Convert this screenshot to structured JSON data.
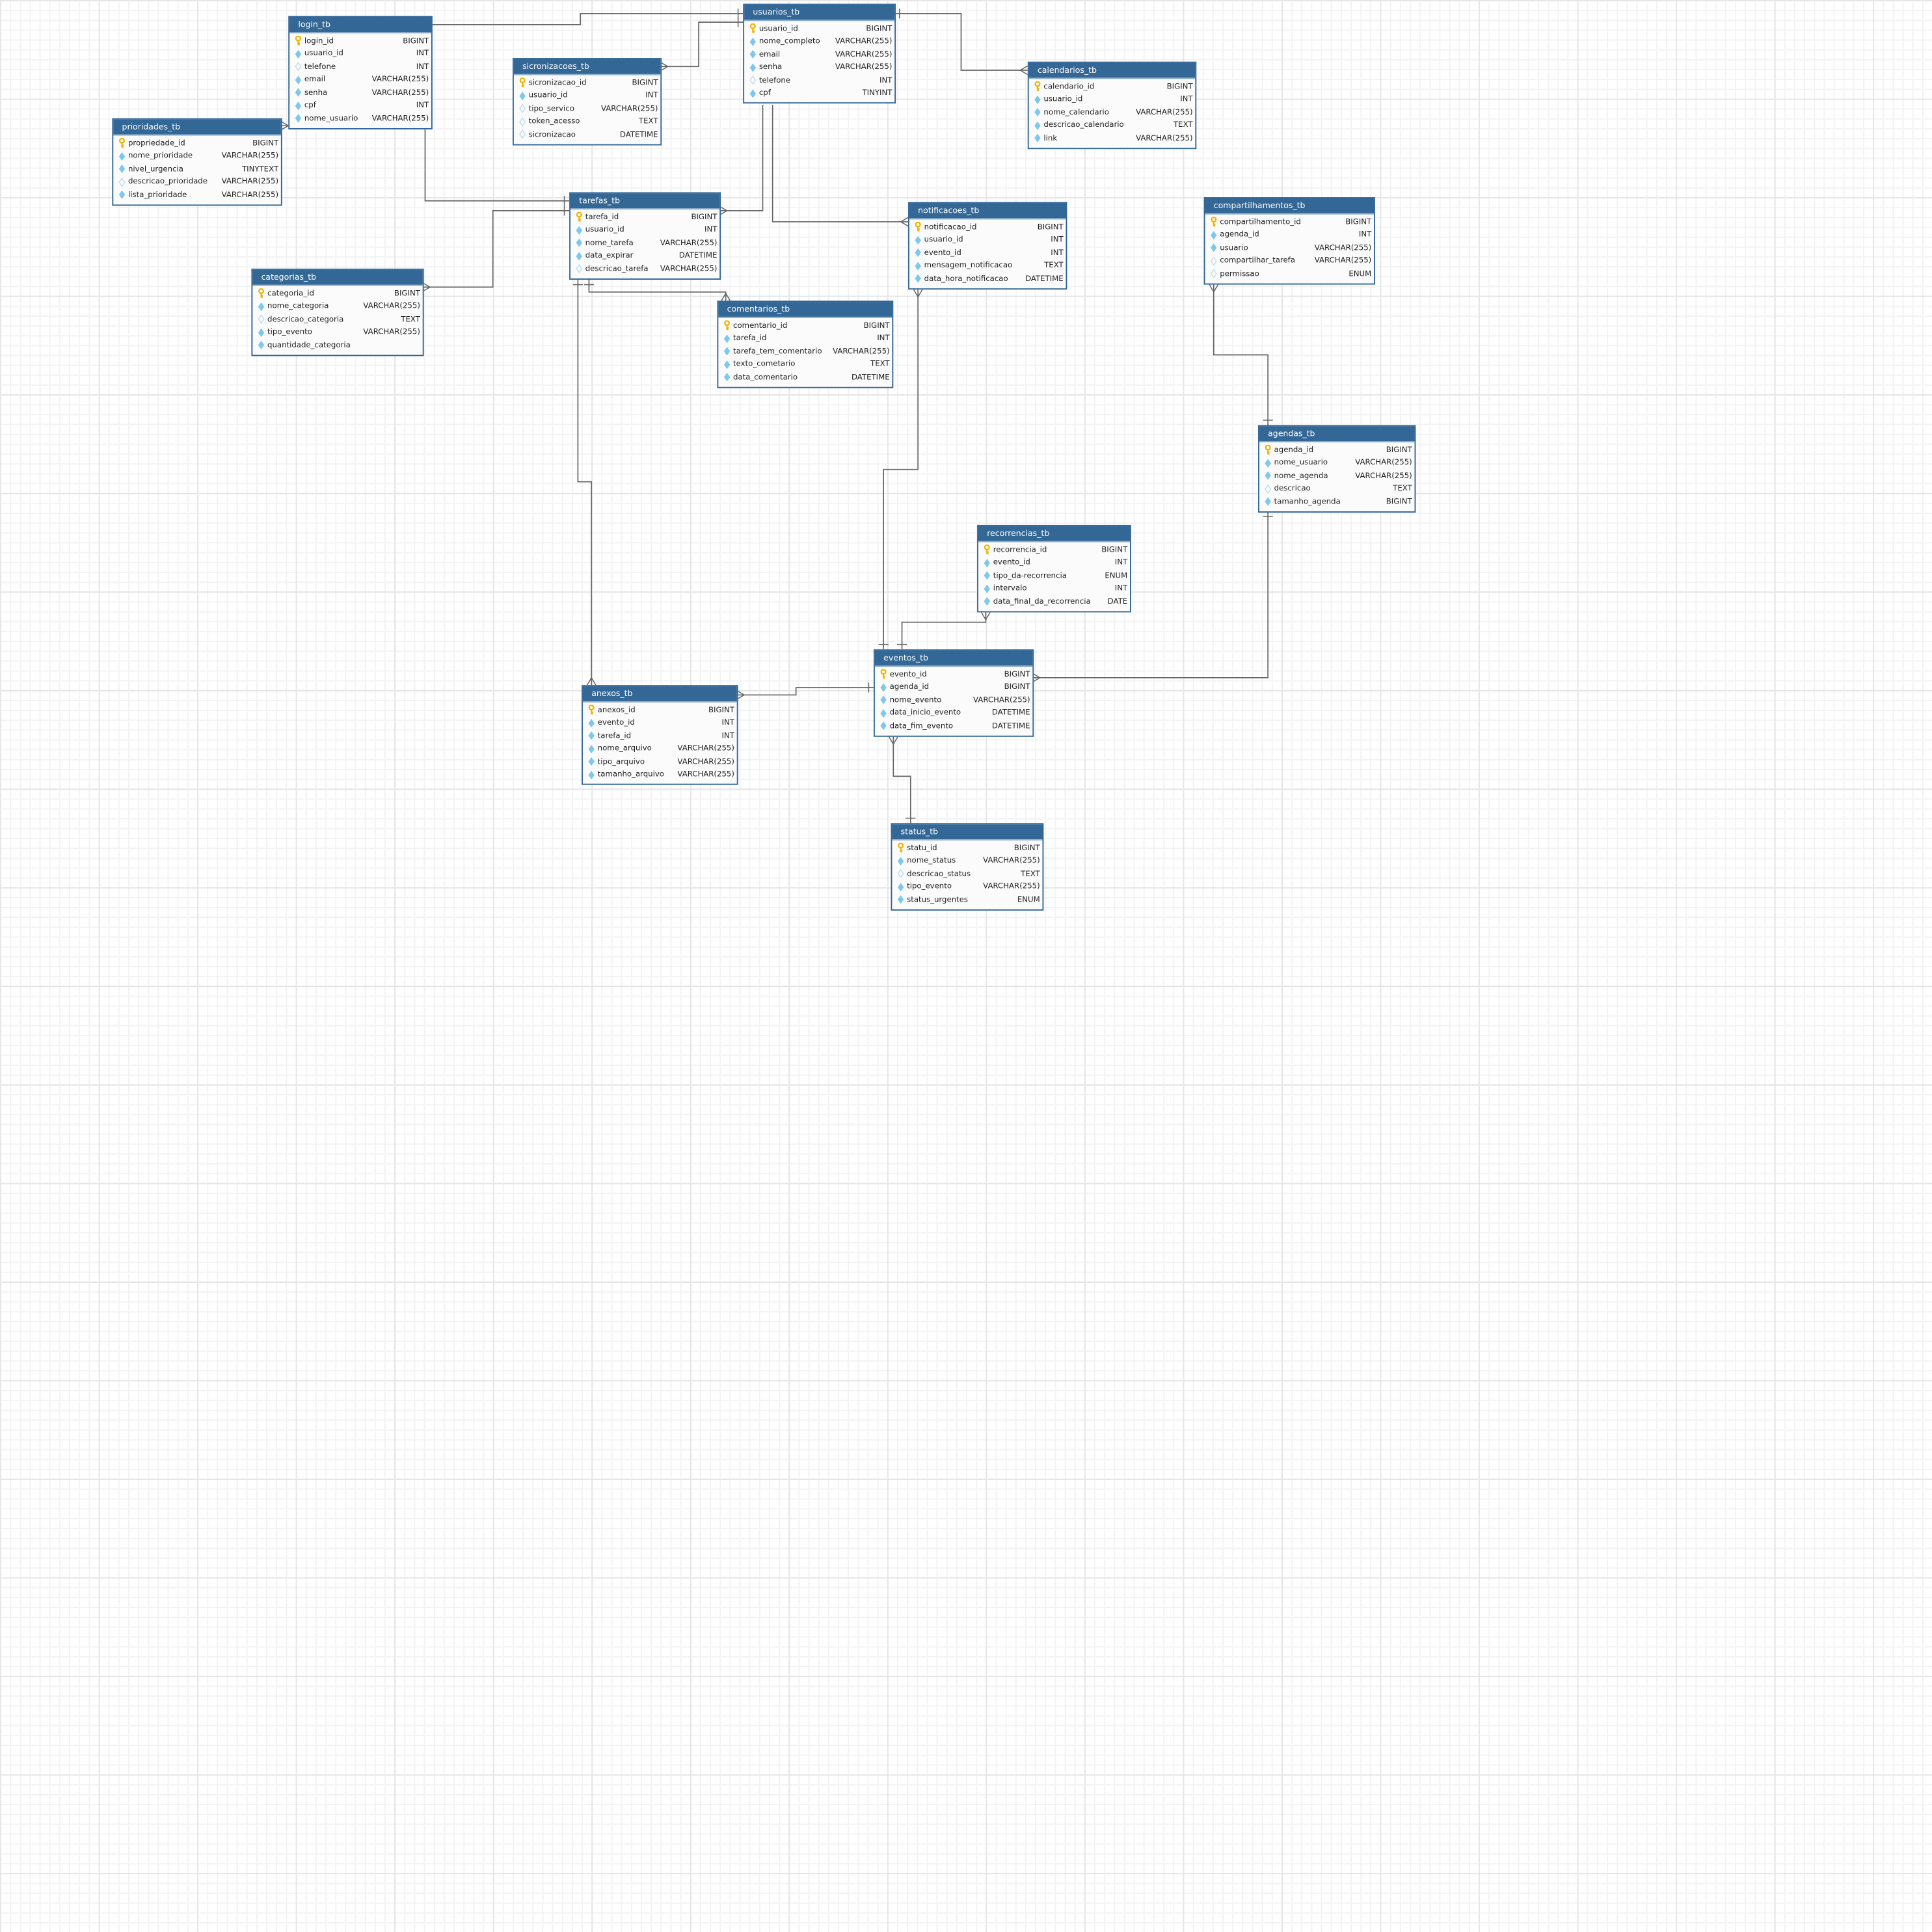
{
  "colors": {
    "header": "#336795",
    "border": "#336699",
    "pk": "#f2b400",
    "field": "#7cc8ef",
    "line": "#666666"
  },
  "tables": [
    {
      "id": "login_tb",
      "name": "login_tb",
      "columns": [
        {
          "name": "login_id",
          "type": "BIGINT",
          "icon": "key"
        },
        {
          "name": "usuario_id",
          "type": "INT",
          "icon": "diamond"
        },
        {
          "name": "telefone",
          "type": "INT",
          "icon": "diamond-outline"
        },
        {
          "name": "email",
          "type": "VARCHAR(255)",
          "icon": "diamond"
        },
        {
          "name": "senha",
          "type": "VARCHAR(255)",
          "icon": "diamond"
        },
        {
          "name": "cpf",
          "type": "INT",
          "icon": "diamond"
        },
        {
          "name": "nome_usuario",
          "type": "VARCHAR(255)",
          "icon": "diamond"
        }
      ]
    },
    {
      "id": "usuarios_tb",
      "name": "usuarios_tb",
      "columns": [
        {
          "name": "usuario_id",
          "type": "BIGINT",
          "icon": "key"
        },
        {
          "name": "nome_completo",
          "type": "VARCHAR(255)",
          "icon": "diamond"
        },
        {
          "name": "email",
          "type": "VARCHAR(255)",
          "icon": "diamond"
        },
        {
          "name": "senha",
          "type": "VARCHAR(255)",
          "icon": "diamond"
        },
        {
          "name": "telefone",
          "type": "INT",
          "icon": "diamond-outline"
        },
        {
          "name": "cpf",
          "type": "TINYINT",
          "icon": "diamond"
        }
      ]
    },
    {
      "id": "sicronizacoes_tb",
      "name": "sicronizacoes_tb",
      "columns": [
        {
          "name": "sicronizacao_id",
          "type": "BIGINT",
          "icon": "key"
        },
        {
          "name": "usuario_id",
          "type": "INT",
          "icon": "diamond"
        },
        {
          "name": "tipo_servico",
          "type": "VARCHAR(255)",
          "icon": "diamond-outline"
        },
        {
          "name": "token_acesso",
          "type": "TEXT",
          "icon": "diamond-outline"
        },
        {
          "name": "sicronizacao",
          "type": "DATETIME",
          "icon": "diamond-outline"
        }
      ]
    },
    {
      "id": "prioridades_tb",
      "name": "prioridades_tb",
      "columns": [
        {
          "name": "propriedade_id",
          "type": "BIGINT",
          "icon": "key"
        },
        {
          "name": "nome_prioridade",
          "type": "VARCHAR(255)",
          "icon": "diamond"
        },
        {
          "name": "nivel_urgencia",
          "type": "TINYTEXT",
          "icon": "diamond"
        },
        {
          "name": "descricao_prioridade",
          "type": "VARCHAR(255)",
          "icon": "diamond-outline"
        },
        {
          "name": "lista_prioridade",
          "type": "VARCHAR(255)",
          "icon": "diamond"
        }
      ]
    },
    {
      "id": "calendarios_tb",
      "name": "calendarios_tb",
      "columns": [
        {
          "name": "calendario_id",
          "type": "BIGINT",
          "icon": "key"
        },
        {
          "name": "usuario_id",
          "type": "INT",
          "icon": "diamond"
        },
        {
          "name": "nome_calendario",
          "type": "VARCHAR(255)",
          "icon": "diamond"
        },
        {
          "name": "descricao_calendario",
          "type": "TEXT",
          "icon": "diamond"
        },
        {
          "name": "link",
          "type": "VARCHAR(255)",
          "icon": "diamond"
        }
      ]
    },
    {
      "id": "tarefas_tb",
      "name": "tarefas_tb",
      "columns": [
        {
          "name": "tarefa_id",
          "type": "BIGINT",
          "icon": "key"
        },
        {
          "name": "usuario_id",
          "type": "INT",
          "icon": "diamond"
        },
        {
          "name": "nome_tarefa",
          "type": "VARCHAR(255)",
          "icon": "diamond"
        },
        {
          "name": "data_expirar",
          "type": "DATETIME",
          "icon": "diamond"
        },
        {
          "name": "descricao_tarefa",
          "type": "VARCHAR(255)",
          "icon": "diamond-outline"
        }
      ]
    },
    {
      "id": "notificacoes_tb",
      "name": "notificacoes_tb",
      "columns": [
        {
          "name": "notificacao_id",
          "type": "BIGINT",
          "icon": "key"
        },
        {
          "name": "usuario_id",
          "type": "INT",
          "icon": "diamond"
        },
        {
          "name": "evento_id",
          "type": "INT",
          "icon": "diamond"
        },
        {
          "name": "mensagem_notificacao",
          "type": "TEXT",
          "icon": "diamond"
        },
        {
          "name": "data_hora_notificacao",
          "type": "DATETIME",
          "icon": "diamond"
        }
      ]
    },
    {
      "id": "compartilhamentos_tb",
      "name": "compartilhamentos_tb",
      "columns": [
        {
          "name": "compartilhamento_id",
          "type": "BIGINT",
          "icon": "key"
        },
        {
          "name": "agenda_id",
          "type": "INT",
          "icon": "diamond"
        },
        {
          "name": "usuario",
          "type": "VARCHAR(255)",
          "icon": "diamond"
        },
        {
          "name": "compartilhar_tarefa",
          "type": "VARCHAR(255)",
          "icon": "diamond-outline"
        },
        {
          "name": "permissao",
          "type": "ENUM",
          "icon": "diamond-outline"
        }
      ]
    },
    {
      "id": "categorias_tb",
      "name": "categorias_tb",
      "columns": [
        {
          "name": "categoria_id",
          "type": "BIGINT",
          "icon": "key"
        },
        {
          "name": "nome_categoria",
          "type": "VARCHAR(255)",
          "icon": "diamond"
        },
        {
          "name": "descricao_categoria",
          "type": "TEXT",
          "icon": "diamond-outline"
        },
        {
          "name": "tipo_evento",
          "type": "VARCHAR(255)",
          "icon": "diamond"
        },
        {
          "name": "quantidade_categoria",
          "type": "",
          "icon": "diamond"
        }
      ]
    },
    {
      "id": "comentarios_tb",
      "name": "comentarios_tb",
      "columns": [
        {
          "name": "comentario_id",
          "type": "BIGINT",
          "icon": "key"
        },
        {
          "name": "tarefa_id",
          "type": "INT",
          "icon": "diamond"
        },
        {
          "name": "tarefa_tem_comentario",
          "type": "VARCHAR(255)",
          "icon": "diamond"
        },
        {
          "name": "texto_cometario",
          "type": "TEXT",
          "icon": "diamond"
        },
        {
          "name": "data_comentario",
          "type": "DATETIME",
          "icon": "diamond"
        }
      ]
    },
    {
      "id": "agendas_tb",
      "name": "agendas_tb",
      "columns": [
        {
          "name": "agenda_id",
          "type": "BIGINT",
          "icon": "key"
        },
        {
          "name": "nome_usuario",
          "type": "VARCHAR(255)",
          "icon": "diamond"
        },
        {
          "name": "nome_agenda",
          "type": "VARCHAR(255)",
          "icon": "diamond"
        },
        {
          "name": "descricao",
          "type": "TEXT",
          "icon": "diamond-outline"
        },
        {
          "name": "tamanho_agenda",
          "type": "BIGINT",
          "icon": "diamond"
        }
      ]
    },
    {
      "id": "recorrencias_tb",
      "name": "recorrencias_tb",
      "columns": [
        {
          "name": "recorrencia_id",
          "type": "BIGINT",
          "icon": "key"
        },
        {
          "name": "evento_id",
          "type": "INT",
          "icon": "diamond"
        },
        {
          "name": "tipo_da-recorrencia",
          "type": "ENUM",
          "icon": "diamond"
        },
        {
          "name": "intervalo",
          "type": "INT",
          "icon": "diamond"
        },
        {
          "name": "data_final_da_recorrencia",
          "type": "DATE",
          "icon": "diamond"
        }
      ]
    },
    {
      "id": "eventos_tb",
      "name": "eventos_tb",
      "columns": [
        {
          "name": "evento_id",
          "type": "BIGINT",
          "icon": "key"
        },
        {
          "name": "agenda_id",
          "type": "BIGINT",
          "icon": "diamond"
        },
        {
          "name": "nome_evento",
          "type": "VARCHAR(255)",
          "icon": "diamond"
        },
        {
          "name": "data_inicio_evento",
          "type": "DATETIME",
          "icon": "diamond"
        },
        {
          "name": "data_fim_evento",
          "type": "DATETIME",
          "icon": "diamond"
        }
      ]
    },
    {
      "id": "anexos_tb",
      "name": "anexos_tb",
      "columns": [
        {
          "name": "anexos_id",
          "type": "BIGINT",
          "icon": "key"
        },
        {
          "name": "evento_id",
          "type": "INT",
          "icon": "diamond"
        },
        {
          "name": "tarefa_id",
          "type": "INT",
          "icon": "diamond"
        },
        {
          "name": "nome_arquivo",
          "type": "VARCHAR(255)",
          "icon": "diamond"
        },
        {
          "name": "tipo_arquivo",
          "type": "VARCHAR(255)",
          "icon": "diamond"
        },
        {
          "name": "tamanho_arquivo",
          "type": "VARCHAR(255)",
          "icon": "diamond"
        }
      ]
    },
    {
      "id": "status_tb",
      "name": "status_tb",
      "columns": [
        {
          "name": "statu_id",
          "type": "BIGINT",
          "icon": "key"
        },
        {
          "name": "nome_status",
          "type": "VARCHAR(255)",
          "icon": "diamond"
        },
        {
          "name": "descricao_status",
          "type": "TEXT",
          "icon": "diamond-outline"
        },
        {
          "name": "tipo_evento",
          "type": "VARCHAR(255)",
          "icon": "diamond"
        },
        {
          "name": "status_urgentes",
          "type": "ENUM",
          "icon": "diamond"
        }
      ]
    }
  ],
  "relationships": [
    {
      "from": "login_tb",
      "to": "usuarios_tb",
      "from_end": "none",
      "to_end": "one"
    },
    {
      "from": "sicronizacoes_tb",
      "to": "usuarios_tb",
      "from_end": "many",
      "to_end": "one"
    },
    {
      "from": "usuarios_tb",
      "to": "calendarios_tb",
      "from_end": "one",
      "to_end": "many"
    },
    {
      "from": "login_tb",
      "to": "tarefas_tb",
      "from_end": "none",
      "to_end": "one"
    },
    {
      "from": "prioridades_tb",
      "to": "login_tb",
      "from_end": "many",
      "to_end": "none"
    },
    {
      "from": "usuarios_tb",
      "to": "tarefas_tb",
      "from_end": "none",
      "to_end": "many"
    },
    {
      "from": "usuarios_tb",
      "to": "notificacoes_tb",
      "from_end": "none",
      "to_end": "many"
    },
    {
      "from": "categorias_tb",
      "to": "tarefas_tb",
      "from_end": "many",
      "to_end": "one"
    },
    {
      "from": "tarefas_tb",
      "to": "comentarios_tb",
      "from_end": "one",
      "to_end": "many"
    },
    {
      "from": "tarefas_tb",
      "to": "anexos_tb",
      "from_end": "one",
      "to_end": "many"
    },
    {
      "from": "notificacoes_tb",
      "to": "eventos_tb",
      "from_end": "many",
      "to_end": "one"
    },
    {
      "from": "recorrencias_tb",
      "to": "eventos_tb",
      "from_end": "many",
      "to_end": "one"
    },
    {
      "from": "compartilhamentos_tb",
      "to": "agendas_tb",
      "from_end": "many",
      "to_end": "one"
    },
    {
      "from": "agendas_tb",
      "to": "eventos_tb",
      "from_end": "one",
      "to_end": "many"
    },
    {
      "from": "anexos_tb",
      "to": "eventos_tb",
      "from_end": "many",
      "to_end": "one"
    },
    {
      "from": "eventos_tb",
      "to": "status_tb",
      "from_end": "many",
      "to_end": "one"
    }
  ]
}
